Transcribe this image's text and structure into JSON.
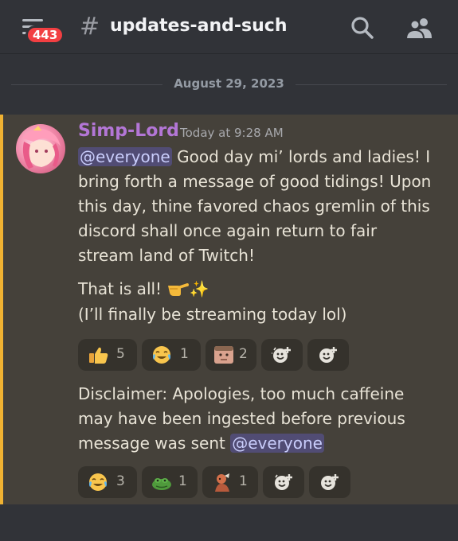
{
  "header": {
    "badge_count": "443",
    "hash": "#",
    "channel_name": "updates-and-such",
    "search_icon": "search-icon",
    "members_icon": "members-icon"
  },
  "divider": {
    "date": "August 29, 2023"
  },
  "message": {
    "username": "Simp-Lord",
    "timestamp": "Today at 9:28 AM",
    "mention": "@everyone",
    "line1_rest": " Good day mi’ lords and ladies! I",
    "line2": "bring forth a message of good tidings! Upon",
    "line3": "this day, thine favored chaos gremlin of this",
    "line4": "discord shall once again return to fair",
    "line5": "stream land of Twitch!",
    "line6": "That is all!",
    "line6_emoji": "✨",
    "line7": "(I’ll finally be streaming today lol)",
    "reactions": [
      {
        "emoji": "thumbs-up",
        "count": "5"
      },
      {
        "emoji": "joy-face",
        "count": "1"
      },
      {
        "emoji": "custom-face",
        "count": "2"
      },
      {
        "emoji": "add-super-reaction-icon",
        "count": ""
      },
      {
        "emoji": "add-reaction-icon",
        "count": ""
      }
    ]
  },
  "followup": {
    "line1": "Disclaimer: Apologies, too much caffeine",
    "line2": "may have been ingested before previous",
    "line3": "message was sent",
    "mention": "@everyone",
    "reactions": [
      {
        "emoji": "joy-face",
        "count": "3"
      },
      {
        "emoji": "frog",
        "count": "1"
      },
      {
        "emoji": "custom-figure",
        "count": "1"
      },
      {
        "emoji": "add-super-reaction-icon",
        "count": ""
      },
      {
        "emoji": "add-reaction-icon",
        "count": ""
      }
    ]
  },
  "colors": {
    "background": "#313338",
    "highlight_background": "#45413a",
    "highlight_bar": "#f0b232",
    "username": "#b376d6",
    "mention_bg": "#514c74",
    "badge": "#f23f42"
  }
}
